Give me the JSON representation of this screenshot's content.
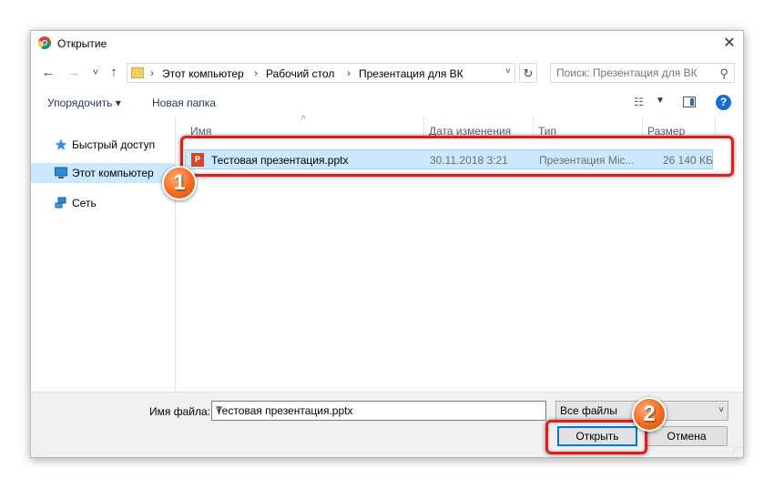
{
  "window": {
    "title": "Открытие",
    "close_glyph": "✕"
  },
  "nav": {
    "back_glyph": "←",
    "forward_glyph": "→",
    "recent_glyph": "˅",
    "up_glyph": "↑",
    "breadcrumb": [
      "Этот компьютер",
      "Рабочий стол",
      "Презентация для ВК"
    ],
    "refresh_glyph": "↻",
    "search_placeholder": "Поиск: Презентация для ВК"
  },
  "toolbar": {
    "organize_label": "Упорядочить ▾",
    "new_folder_label": "Новая папка"
  },
  "sidebar": {
    "items": [
      {
        "label": "Быстрый доступ",
        "icon": "star-icon"
      },
      {
        "label": "Этот компьютер",
        "icon": "computer-icon"
      },
      {
        "label": "Сеть",
        "icon": "network-icon"
      }
    ]
  },
  "columns": {
    "name": "Имя",
    "date": "Дата изменения",
    "type": "Тип",
    "size": "Размер"
  },
  "files": [
    {
      "name": "Тестовая презентация.pptx",
      "date": "30.11.2018 3:21",
      "type": "Презентация Mic...",
      "size": "26 140 КБ",
      "icon": "pptx-file-icon"
    }
  ],
  "footer": {
    "filename_label": "Имя файла:",
    "filename_value": "Тестовая презентация.pptx",
    "filter_value": "Все файлы",
    "open_label": "Открыть",
    "cancel_label": "Отмена"
  },
  "annotations": {
    "step1": "1",
    "step2": "2",
    "highlight_color": "#e21b1b",
    "badge_color": "#f26a1d"
  },
  "colors": {
    "selection": "#cce8ff",
    "accent": "#0078d7",
    "help": "#1a6dd1"
  }
}
